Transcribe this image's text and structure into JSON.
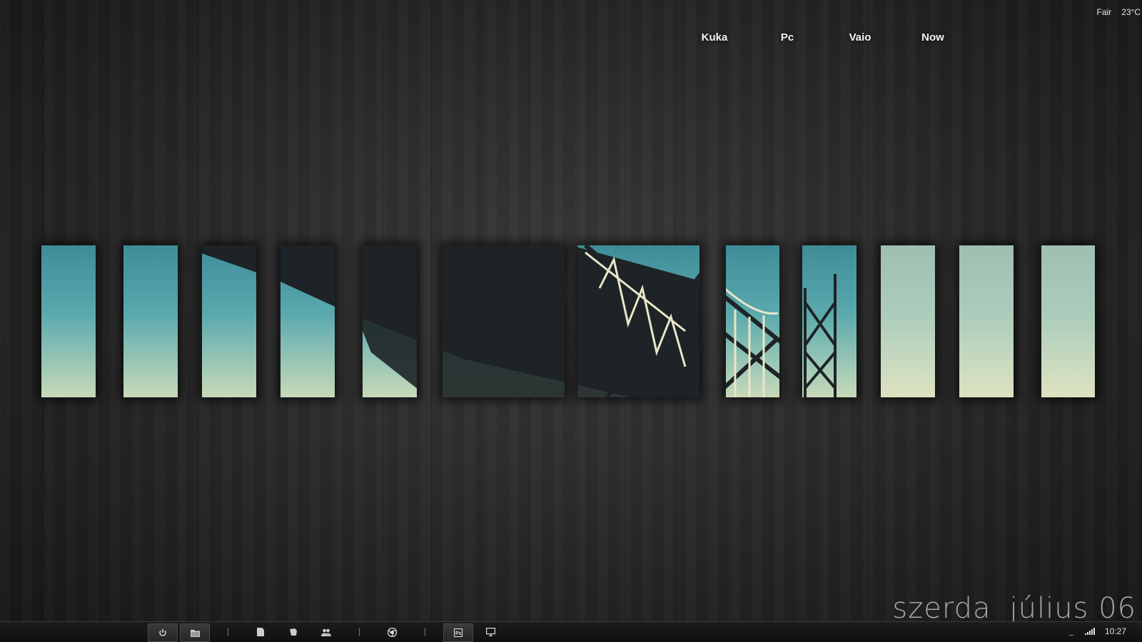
{
  "weather": {
    "condition": "Fair",
    "temperature": "23°C"
  },
  "shortcuts": [
    {
      "label": "Kuka"
    },
    {
      "label": "Pc"
    },
    {
      "label": "Vaio"
    },
    {
      "label": "Now"
    }
  ],
  "date": {
    "weekday": "szerda",
    "month_day": "július 06"
  },
  "taskbar": {
    "clock": "10:27",
    "buttons": [
      {
        "icon": "power-icon"
      },
      {
        "icon": "folder-icon"
      },
      {
        "icon": "document-icon"
      },
      {
        "icon": "notes-icon"
      },
      {
        "icon": "users-icon"
      },
      {
        "icon": "chrome-icon"
      },
      {
        "icon": "photoshop-icon"
      },
      {
        "icon": "monitor-icon"
      }
    ]
  },
  "wallpaper": {
    "panel_colors": {
      "sky_top": "#3f8c98",
      "sky_bottom": "#c8d9b8",
      "bridge": "#1d2326"
    },
    "panel_count": 12
  }
}
